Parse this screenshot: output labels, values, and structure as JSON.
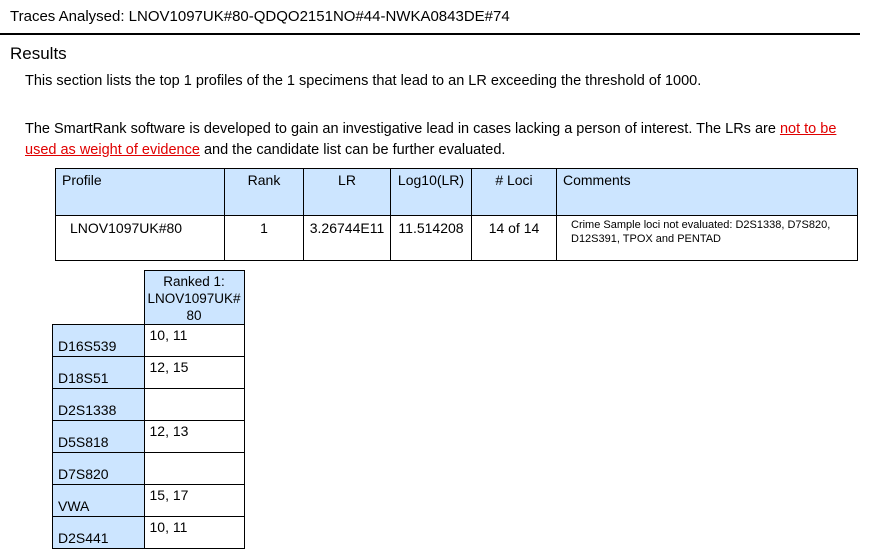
{
  "header": {
    "traces_line": "Traces Analysed: LNOV1097UK#80-QDQO2151NO#44-NWKA0843DE#74"
  },
  "results": {
    "title": "Results",
    "intro": "This section lists the top 1 profiles of the 1 specimens that lead to an LR exceeding the threshold of 1000.",
    "para_prefix": "The SmartRank software is developed to gain an investigative lead in cases lacking a person of interest. The LRs are ",
    "para_link": "not to be used as weight of evidence",
    "para_suffix": " and the candidate list can be further evaluated."
  },
  "summary_table": {
    "headers": {
      "profile": "Profile",
      "rank": "Rank",
      "lr": "LR",
      "log": "Log10(LR)",
      "loci": "# Loci",
      "comments": "Comments"
    },
    "rows": [
      {
        "profile": "LNOV1097UK#80",
        "rank": "1",
        "lr": "3.26744E11",
        "log": "11.514208",
        "loci": "14 of 14",
        "comments": "Crime Sample loci not evaluated: D2S1338, D7S820, D12S391, TPOX and PENTAD"
      }
    ]
  },
  "loci_table": {
    "column_header": "Ranked 1: LNOV1097UK# 80",
    "rows": [
      {
        "locus": "D16S539",
        "alleles": "10, 11"
      },
      {
        "locus": "D18S51",
        "alleles": "12, 15"
      },
      {
        "locus": "D2S1338",
        "alleles": ""
      },
      {
        "locus": "D5S818",
        "alleles": "12, 13"
      },
      {
        "locus": "D7S820",
        "alleles": ""
      },
      {
        "locus": "VWA",
        "alleles": "15, 17"
      },
      {
        "locus": "D2S441",
        "alleles": "10, 11"
      }
    ]
  },
  "colors": {
    "header_fill": "#cce5ff",
    "link": "#e00000"
  }
}
